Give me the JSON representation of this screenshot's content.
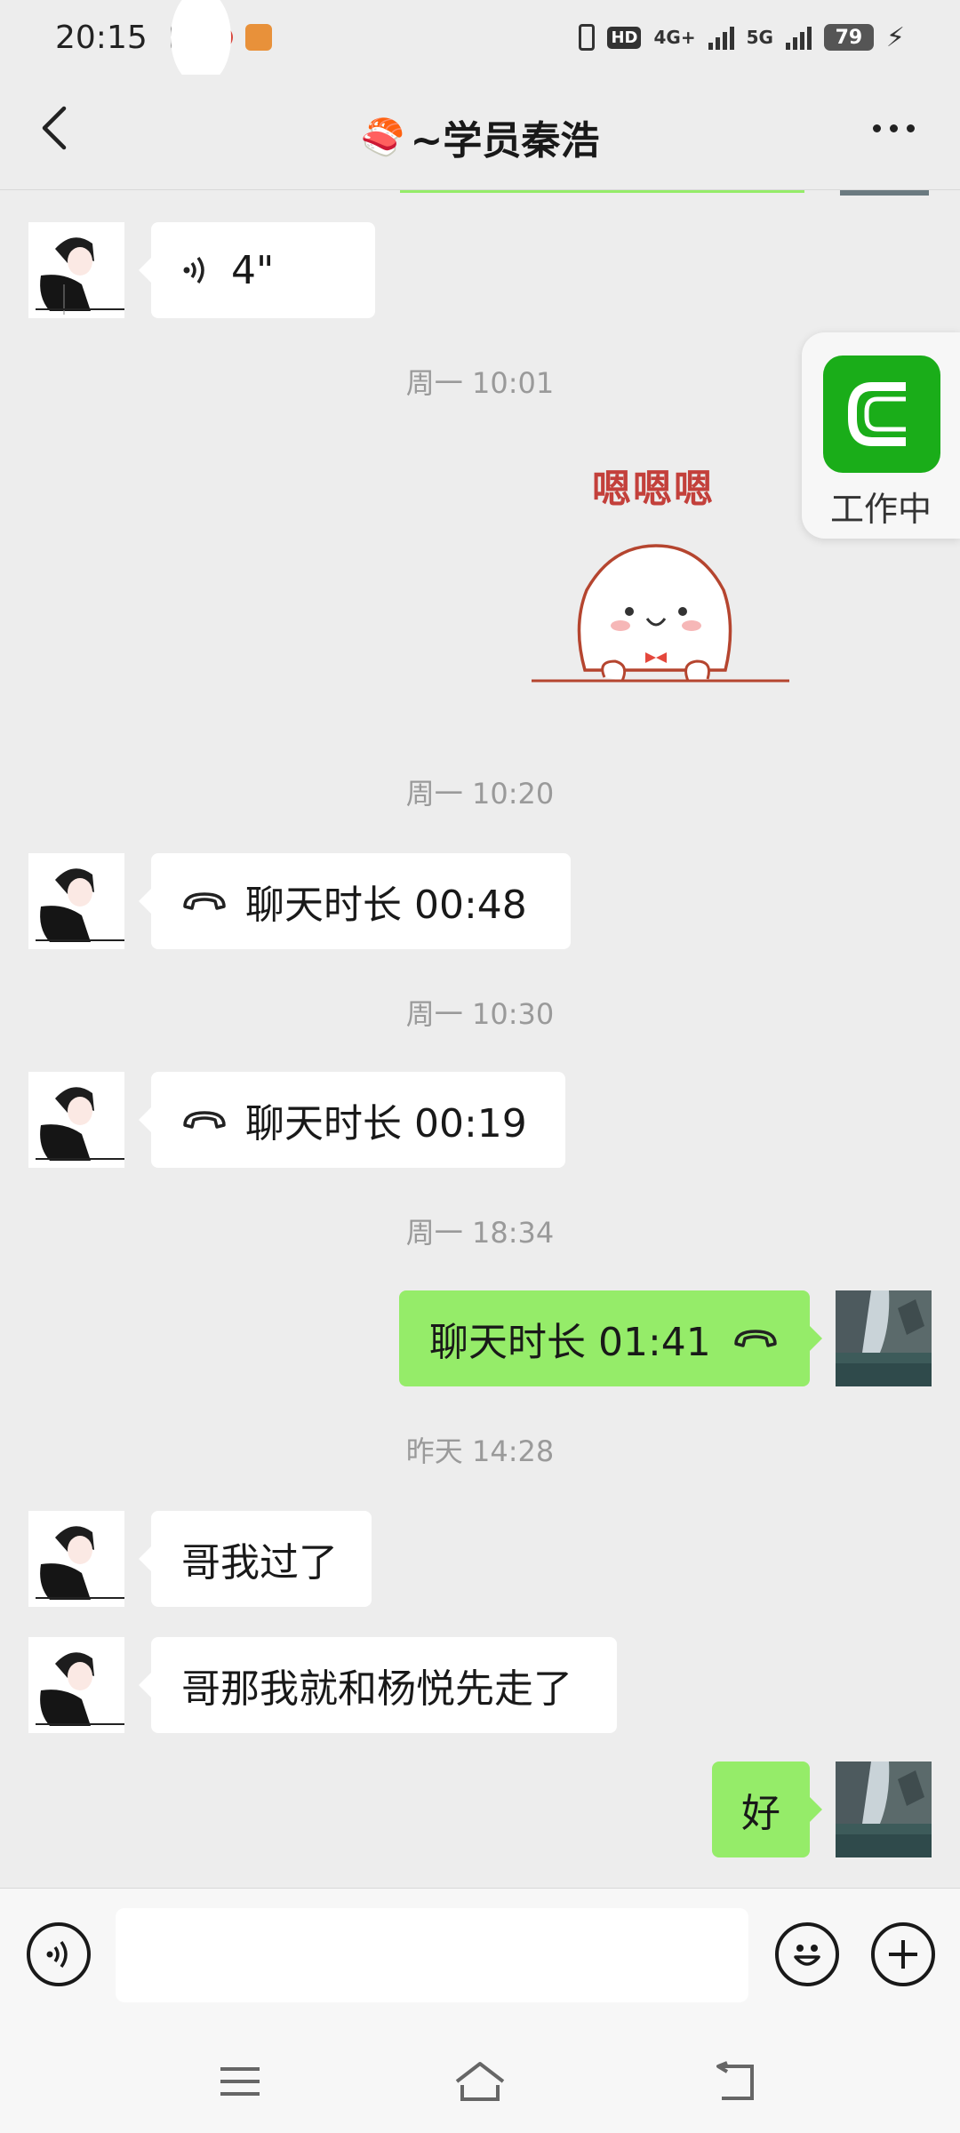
{
  "status_bar": {
    "time": "20:15",
    "hd_label": "HD",
    "network_4g": "4G+",
    "network_5g": "5G",
    "battery": "79"
  },
  "header": {
    "title_emoji": "🍣",
    "title": "~学员秦浩"
  },
  "floating_widget": {
    "label": "工作中"
  },
  "sticker": {
    "text": "嗯嗯嗯"
  },
  "messages": {
    "voice": {
      "duration": "4\""
    },
    "ts1": "周一 10:01",
    "ts2": "周一 10:20",
    "call1": "聊天时长  00:48",
    "ts3": "周一 10:30",
    "call2": "聊天时长  00:19",
    "ts4": "周一 18:34",
    "call3": "聊天时长  01:41",
    "ts5": "昨天 14:28",
    "text1": "哥我过了",
    "text2": "哥那我就和杨悦先走了",
    "text3": "好"
  },
  "input_bar": {
    "placeholder": ""
  },
  "colors": {
    "self_bubble": "#95ec69",
    "other_bubble": "#ffffff",
    "background": "#ededed",
    "floating_app": "#1aad19"
  }
}
